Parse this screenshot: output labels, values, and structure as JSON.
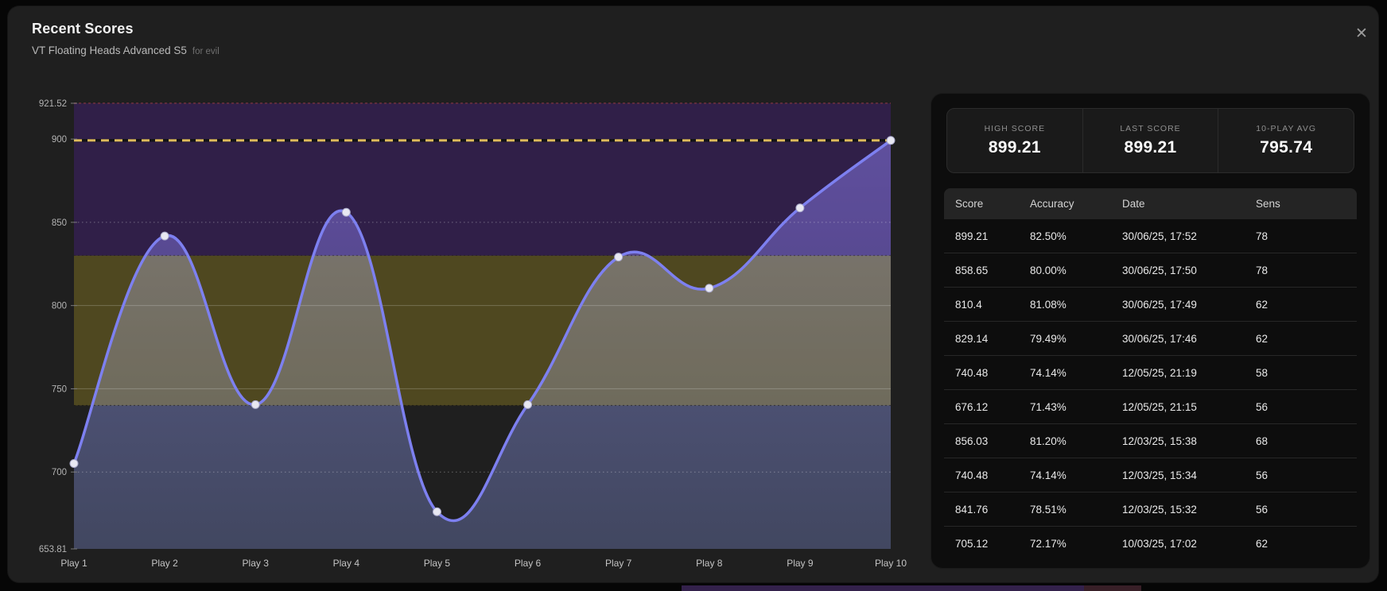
{
  "header": {
    "title": "Recent Scores",
    "scenario": "VT Floating Heads Advanced S5",
    "suffix": "for evil",
    "close_glyph": "✕"
  },
  "stats": [
    {
      "label": "HIGH SCORE",
      "value": "899.21"
    },
    {
      "label": "LAST SCORE",
      "value": "899.21"
    },
    {
      "label": "10-PLAY AVG",
      "value": "795.74"
    }
  ],
  "table": {
    "columns": [
      "Score",
      "Accuracy",
      "Date",
      "Sens"
    ],
    "rows": [
      [
        "899.21",
        "82.50%",
        "30/06/25, 17:52",
        "78"
      ],
      [
        "858.65",
        "80.00%",
        "30/06/25, 17:50",
        "78"
      ],
      [
        "810.4",
        "81.08%",
        "30/06/25, 17:49",
        "62"
      ],
      [
        "829.14",
        "79.49%",
        "30/06/25, 17:46",
        "62"
      ],
      [
        "740.48",
        "74.14%",
        "12/05/25, 21:19",
        "58"
      ],
      [
        "676.12",
        "71.43%",
        "12/05/25, 21:15",
        "56"
      ],
      [
        "856.03",
        "81.20%",
        "12/03/25, 15:38",
        "68"
      ],
      [
        "740.48",
        "74.14%",
        "12/03/25, 15:34",
        "56"
      ],
      [
        "841.76",
        "78.51%",
        "12/03/25, 15:32",
        "56"
      ],
      [
        "705.12",
        "72.17%",
        "10/03/25, 17:02",
        "62"
      ]
    ]
  },
  "chart_data": {
    "type": "line",
    "x": [
      "Play 1",
      "Play 2",
      "Play 3",
      "Play 4",
      "Play 5",
      "Play 6",
      "Play 7",
      "Play 8",
      "Play 9",
      "Play 10"
    ],
    "series": [
      {
        "name": "Score",
        "values": [
          705.12,
          841.76,
          740.48,
          856.03,
          676.12,
          740.48,
          829.14,
          810.4,
          858.65,
          899.21
        ]
      }
    ],
    "ylim": [
      653.81,
      921.52
    ],
    "yticks": [
      {
        "v": 921.52,
        "label": "921.52"
      },
      {
        "v": 900,
        "label": "900"
      },
      {
        "v": 850,
        "label": "850"
      },
      {
        "v": 800,
        "label": "800"
      },
      {
        "v": 750,
        "label": "750"
      },
      {
        "v": 700,
        "label": "700"
      },
      {
        "v": 653.81,
        "label": "653.81"
      }
    ],
    "grid": {
      "solid_at": [
        800,
        750
      ],
      "dotted_at": [
        850,
        700
      ]
    },
    "high_score_line": {
      "value": 899.21,
      "color": "#deba5c"
    },
    "top_line": {
      "value": 921.52,
      "color": "#5e2c3c"
    },
    "bands": [
      {
        "name": "high-band",
        "from": 830,
        "to": 921.52,
        "color": "rgba(93,33,178,0.28)"
      },
      {
        "name": "middle-band",
        "from": 740,
        "to": 830,
        "color": "rgba(204,178,37,0.28)"
      }
    ],
    "line_color": "#7d80f0",
    "point_color": "#e8e8f2",
    "area_top": "rgba(122,124,196,0.72)",
    "area_bottom": "rgba(94,104,150,0.55)",
    "legend": "off"
  }
}
